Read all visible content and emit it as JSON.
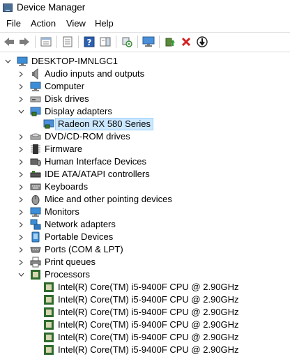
{
  "window": {
    "title": "Device Manager"
  },
  "menu": [
    "File",
    "Action",
    "View",
    "Help"
  ],
  "toolbar": {
    "icons": [
      "back-arrow-icon",
      "forward-arrow-icon",
      "properties-sheet-icon",
      "show-hidden-icon",
      "help-icon",
      "action-pane-icon",
      "scan-hardware-icon",
      "monitor-icon",
      "update-driver-icon",
      "uninstall-icon",
      "disable-device-icon"
    ]
  },
  "tree": {
    "root": "DESKTOP-IMNLGC1",
    "categories": [
      {
        "label": "Audio inputs and outputs",
        "icon": "speaker-icon",
        "expanded": false
      },
      {
        "label": "Computer",
        "icon": "computer-icon",
        "expanded": false
      },
      {
        "label": "Disk drives",
        "icon": "disk-drive-icon",
        "expanded": false
      },
      {
        "label": "Display adapters",
        "icon": "display-adapter-icon",
        "expanded": true,
        "children": [
          {
            "label": "Radeon RX 580 Series",
            "selected": true
          }
        ]
      },
      {
        "label": "DVD/CD-ROM drives",
        "icon": "dvd-icon",
        "expanded": false
      },
      {
        "label": "Firmware",
        "icon": "firmware-icon",
        "expanded": false
      },
      {
        "label": "Human Interface Devices",
        "icon": "hid-icon",
        "expanded": false
      },
      {
        "label": "IDE ATA/ATAPI controllers",
        "icon": "ide-controller-icon",
        "expanded": false
      },
      {
        "label": "Keyboards",
        "icon": "keyboard-icon",
        "expanded": false
      },
      {
        "label": "Mice and other pointing devices",
        "icon": "mouse-icon",
        "expanded": false
      },
      {
        "label": "Monitors",
        "icon": "monitor-icon",
        "expanded": false
      },
      {
        "label": "Network adapters",
        "icon": "network-icon",
        "expanded": false
      },
      {
        "label": "Portable Devices",
        "icon": "portable-device-icon",
        "expanded": false
      },
      {
        "label": "Ports (COM & LPT)",
        "icon": "port-icon",
        "expanded": false
      },
      {
        "label": "Print queues",
        "icon": "printer-icon",
        "expanded": false
      },
      {
        "label": "Processors",
        "icon": "processor-icon",
        "expanded": true,
        "children": [
          {
            "label": "Intel(R) Core(TM) i5-9400F CPU @ 2.90GHz"
          },
          {
            "label": "Intel(R) Core(TM) i5-9400F CPU @ 2.90GHz"
          },
          {
            "label": "Intel(R) Core(TM) i5-9400F CPU @ 2.90GHz"
          },
          {
            "label": "Intel(R) Core(TM) i5-9400F CPU @ 2.90GHz"
          },
          {
            "label": "Intel(R) Core(TM) i5-9400F CPU @ 2.90GHz"
          },
          {
            "label": "Intel(R) Core(TM) i5-9400F CPU @ 2.90GHz"
          }
        ]
      }
    ]
  }
}
